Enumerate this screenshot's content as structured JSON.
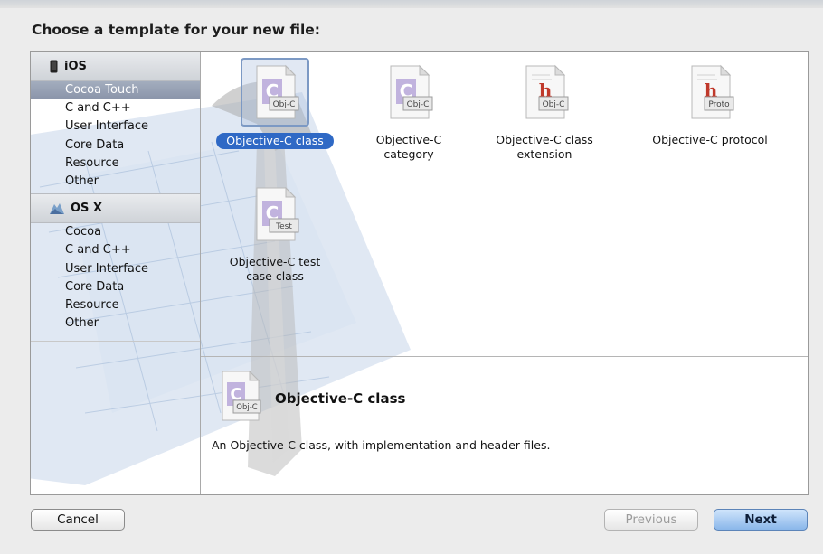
{
  "dialog": {
    "heading": "Choose a template for your new file:"
  },
  "sidebar": {
    "groups": [
      {
        "title": "iOS",
        "icon": "iphone-icon",
        "items": [
          "Cocoa Touch",
          "C and C++",
          "User Interface",
          "Core Data",
          "Resource",
          "Other"
        ],
        "selected": "Cocoa Touch"
      },
      {
        "title": "OS X",
        "icon": "mac-os-x-icon",
        "items": [
          "Cocoa",
          "C and C++",
          "User Interface",
          "Core Data",
          "Resource",
          "Other"
        ]
      }
    ]
  },
  "templates": [
    {
      "label_lines": [
        "Objective-C class"
      ],
      "badge": "Obj-C",
      "glyph": "C",
      "selected": true
    },
    {
      "label_lines": [
        "Objective-C",
        "category"
      ],
      "badge": "Obj-C",
      "glyph": "C"
    },
    {
      "label_lines": [
        "Objective-C class",
        "extension"
      ],
      "badge": "Obj-C",
      "glyph": "h"
    },
    {
      "label_lines": [
        "Objective-C protocol"
      ],
      "badge": "Proto",
      "glyph": "h"
    },
    {
      "label_lines": [
        "Objective-C test",
        "case class"
      ],
      "badge": "Test",
      "glyph": "C"
    }
  ],
  "detail": {
    "title": "Objective-C class",
    "badge": "Obj-C",
    "description": "An Objective-C class, with implementation and header files."
  },
  "buttons": {
    "cancel": "Cancel",
    "previous": "Previous",
    "next": "Next"
  },
  "colors": {
    "selection": "#2f69c5",
    "sidebar_selection": "#8a94a9",
    "accent_button": "#8ab7ea"
  }
}
